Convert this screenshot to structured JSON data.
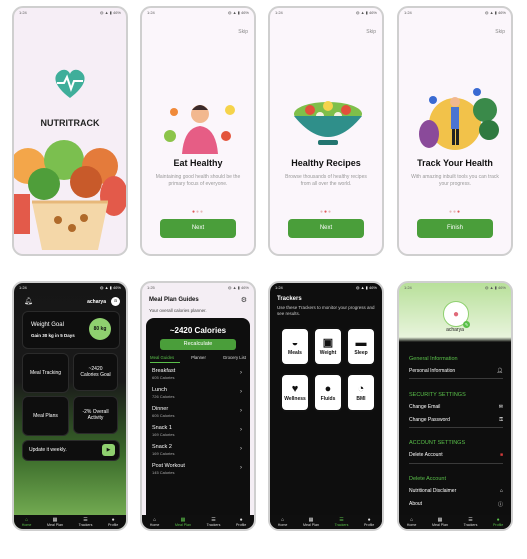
{
  "status": {
    "time": "1:24",
    "time2": "1:25",
    "icons": "◍ ▲ ▮ 46%"
  },
  "splash": {
    "app_name": "NUTRITRACK"
  },
  "onboarding": [
    {
      "skip": "Skip",
      "title": "Eat Healthy",
      "desc": "Maintaining good health should be the primary focus of everyone.",
      "button": "Next"
    },
    {
      "skip": "Skip",
      "title": "Healthy Recipes",
      "desc": "Browse thousands of healthy recipes from all over the world.",
      "button": "Next"
    },
    {
      "skip": "Skip",
      "title": "Track Your Health",
      "desc": "With amazing inbuilt tools you can track your progress.",
      "button": "Finish"
    }
  ],
  "home": {
    "username": "acharya",
    "avatar_initial": "a",
    "weight_goal_title": "Weight Goal",
    "weight_goal_text": "Gain 30 kg in 5 Days",
    "weight_goal_badge": "80 kg",
    "tiles": [
      {
        "label": "Meal Tracking"
      },
      {
        "label": "~2420 Calories Goal"
      },
      {
        "label": "Meal Plans"
      },
      {
        "label": "-2% Overall Activity"
      }
    ],
    "update_text": "Update it weekly.",
    "update_button": "▶"
  },
  "nav": {
    "home": "Home",
    "meal_plan": "Meal Plan",
    "trackers": "Trackers",
    "profile": "Profile"
  },
  "mealplan": {
    "title": "Meal Plan Guides",
    "subtitle": "Your overall calories planner.",
    "calories": "~2420 Calories",
    "recalc": "Recalculate",
    "tabs": [
      "Meal Guides",
      "Planner",
      "Grocery List"
    ],
    "items": [
      {
        "name": "Breakfast",
        "cal": "605 Calories"
      },
      {
        "name": "Lunch",
        "cal": "726 Calories"
      },
      {
        "name": "Dinner",
        "cal": "605 Calories"
      },
      {
        "name": "Snack 1",
        "cal": "169 Calories"
      },
      {
        "name": "Snack 2",
        "cal": "169 Calories"
      },
      {
        "name": "Post Workout",
        "cal": "145 Calories"
      }
    ]
  },
  "trackers": {
    "title": "Trackers",
    "subtitle": "Use these Trackers to monitor your progress and see results.",
    "items": [
      {
        "label": "Meals"
      },
      {
        "label": "Weight"
      },
      {
        "label": "Sleep"
      },
      {
        "label": "Wellness"
      },
      {
        "label": "Fluids"
      },
      {
        "label": "BMI"
      }
    ]
  },
  "profile": {
    "username": "acharya",
    "sec_general": "General Information",
    "personal": "Personal Information",
    "sec_security": "SECURITY SETTINGS",
    "change_email": "Change Email",
    "change_password": "Change Password",
    "sec_account": "ACCOUNT SETTINGS",
    "delete_account": "Delete Account",
    "sec_delete": "Delete Account",
    "disclaimer": "Nutritional Disclaimer",
    "about": "About"
  },
  "colors": {
    "accent": "#4a9e3a",
    "dark": "#0e0e0e",
    "danger": "#d23b3b"
  }
}
